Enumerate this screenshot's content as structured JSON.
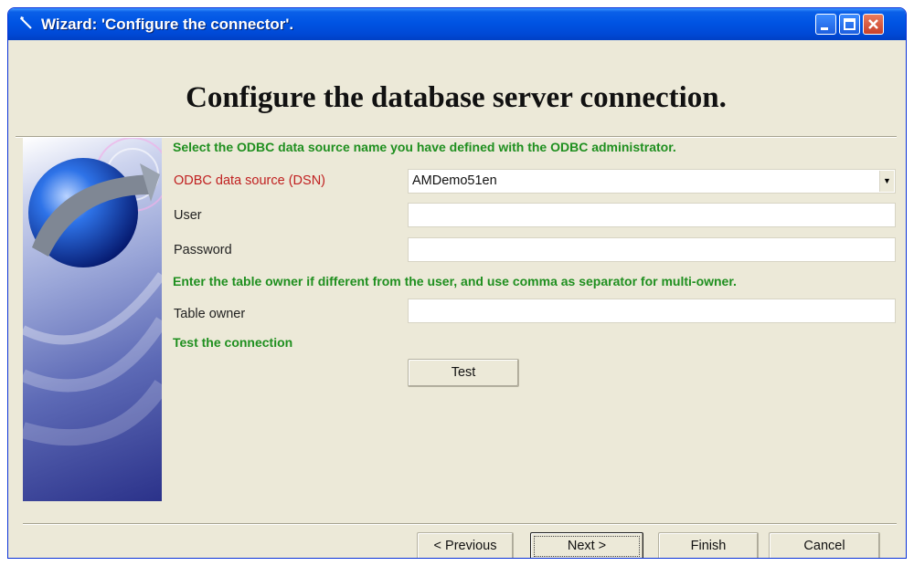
{
  "window": {
    "title": "Wizard: 'Configure the connector'."
  },
  "header": {
    "title": "Configure the database server connection."
  },
  "dsn_section": {
    "instruction": "Select the ODBC data source name you have defined with the ODBC administrator.",
    "dsn_label": "ODBC data source (DSN)",
    "dsn_value": "AMDemo51en",
    "user_label": "User",
    "user_value": "",
    "password_label": "Password",
    "password_value": ""
  },
  "owner_section": {
    "instruction": "Enter the table owner if different from the user, and use comma as separator for multi-owner.",
    "owner_label": "Table owner",
    "owner_value": ""
  },
  "test_section": {
    "instruction": "Test the connection",
    "test_button": "Test"
  },
  "footer": {
    "previous_button": "< Previous",
    "next_button": "Next >",
    "finish_button": "Finish",
    "cancel_button": "Cancel"
  },
  "colors": {
    "section_text": "#1f8f1f",
    "required_label": "#c02020",
    "dialog_bg": "#ece9d8",
    "titlebar": "#0054e3"
  }
}
